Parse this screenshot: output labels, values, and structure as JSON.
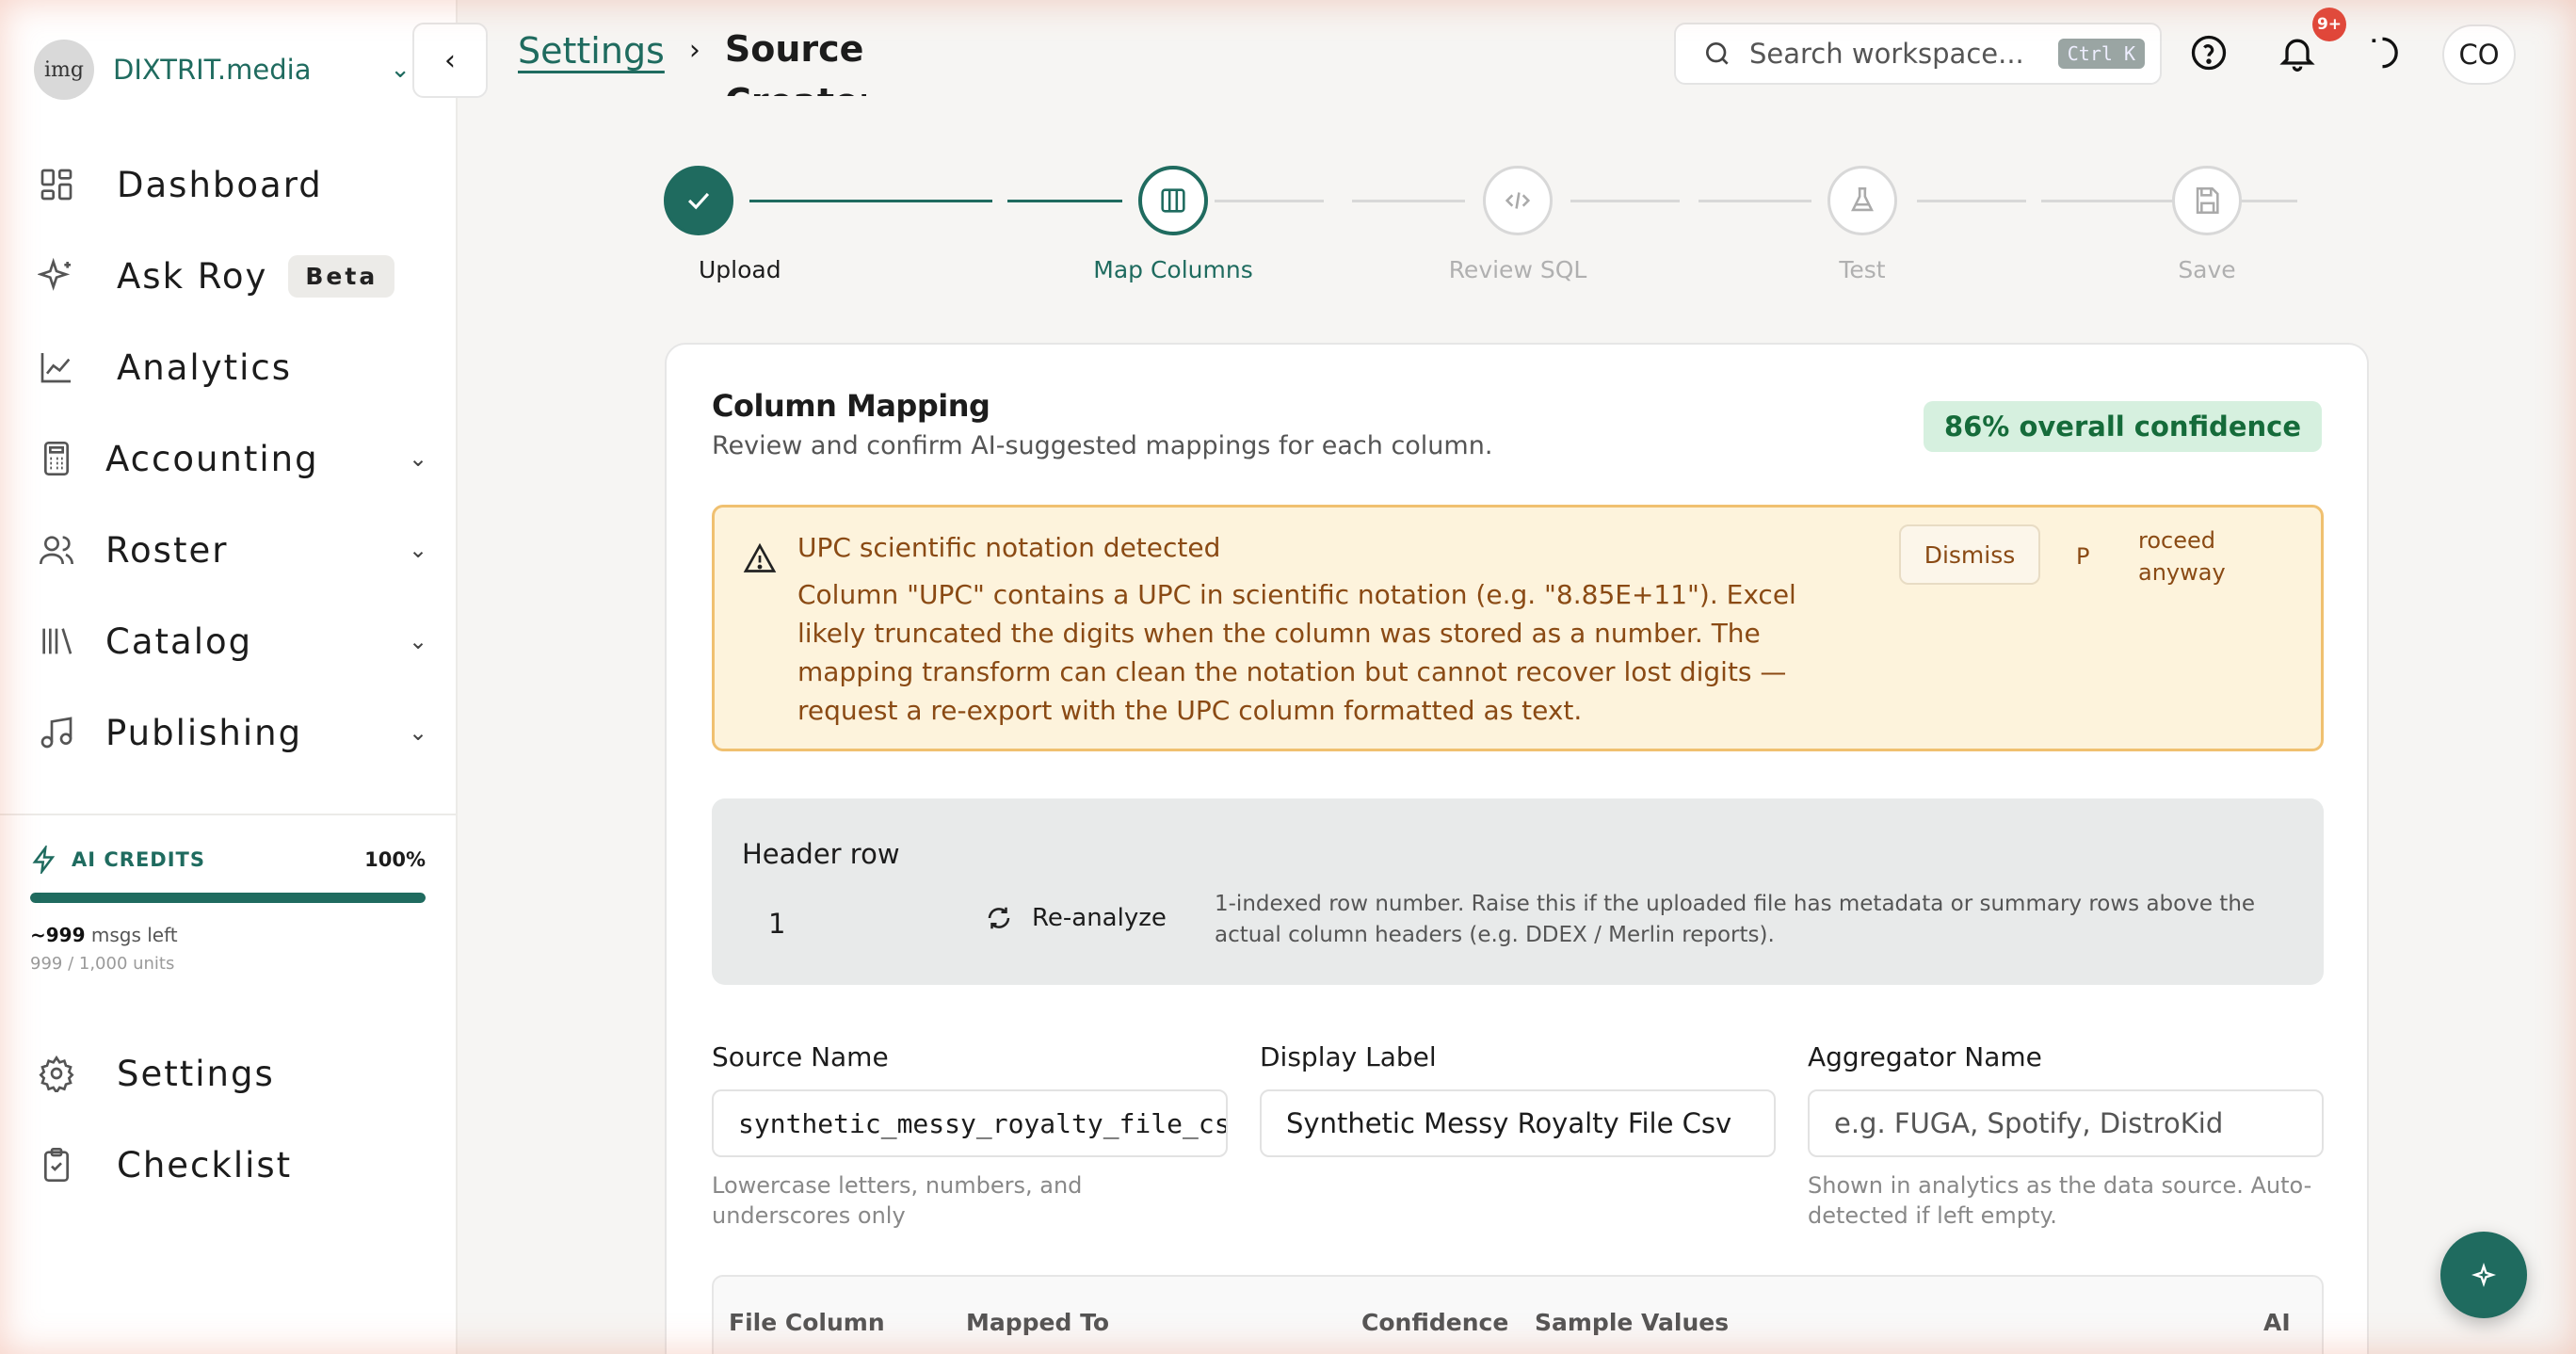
{
  "workspace": {
    "avatar_text": "img",
    "name": "DIXTRIT.media"
  },
  "nav": {
    "items": [
      {
        "label": "Dashboard",
        "icon": "dashboard-icon"
      },
      {
        "label": "Ask Roy",
        "icon": "sparkle-icon",
        "badge": "Beta"
      },
      {
        "label": "Analytics",
        "icon": "chart-line-icon"
      },
      {
        "label": "Accounting",
        "icon": "calculator-icon"
      },
      {
        "label": "Roster",
        "icon": "users-icon"
      },
      {
        "label": "Catalog",
        "icon": "library-icon"
      },
      {
        "label": "Publishing",
        "icon": "music-note-icon"
      }
    ],
    "bottom": [
      {
        "label": "Settings",
        "icon": "gear-icon"
      },
      {
        "label": "Checklist",
        "icon": "clipboard-check-icon"
      }
    ]
  },
  "credits": {
    "title": "AI CREDITS",
    "percent_label": "100%",
    "level": 1.0,
    "msgs_count": "~999",
    "msgs_suffix": "msgs left",
    "units": "999 / 1,000 units"
  },
  "breadcrumb": {
    "parent": "Settings",
    "current": "Source Creator"
  },
  "search": {
    "placeholder": "Search workspace...",
    "shortcut": "Ctrl K"
  },
  "notifications": {
    "badge": "9+"
  },
  "user": {
    "initials": "CO"
  },
  "stepper": {
    "steps": [
      {
        "label": "Upload",
        "state": "done"
      },
      {
        "label": "Map Columns",
        "state": "active"
      },
      {
        "label": "Review SQL",
        "state": "pending"
      },
      {
        "label": "Test",
        "state": "pending"
      },
      {
        "label": "Save",
        "state": "pending"
      }
    ]
  },
  "mapping": {
    "title": "Column Mapping",
    "subtitle": "Review and confirm AI-suggested mappings for each column.",
    "confidence": "86% overall confidence"
  },
  "warning": {
    "title": "UPC scientific notation detected",
    "body": "Column \"UPC\" contains a UPC in scientific notation (e.g. \"8.85E+11\"). Excel likely truncated the digits when the column was stored as a number. The mapping transform can clean the notation but cannot recover lost digits — request a re-export with the UPC column formatted as text.",
    "dismiss": "Dismiss",
    "proceed_p": "P",
    "proceed_rest": "roceed anyway"
  },
  "header_row": {
    "label": "Header row",
    "value": "1",
    "reanalyze": "Re-analyze",
    "help": "1-indexed row number. Raise this if the uploaded file has metadata or summary rows above the actual column headers (e.g. DDEX / Merlin reports)."
  },
  "fields": {
    "source_name": {
      "label": "Source Name",
      "value": "synthetic_messy_royalty_file_csv",
      "hint": "Lowercase letters, numbers, and underscores only"
    },
    "display_label": {
      "label": "Display Label",
      "value": "Synthetic Messy Royalty File Csv"
    },
    "aggregator": {
      "label": "Aggregator Name",
      "placeholder": "e.g. FUGA, Spotify, DistroKid",
      "hint": "Shown in analytics as the data source. Auto-detected if left empty."
    }
  },
  "table": {
    "headers": [
      "File Column",
      "Mapped To",
      "Confidence",
      "Sample Values",
      "AI"
    ]
  },
  "colors": {
    "accent": "#1f6b5f",
    "warning_bg": "#fdf3dc",
    "warning_border": "#f0c070",
    "badge_bg": "#d6f0df",
    "notif": "#e0473a"
  }
}
